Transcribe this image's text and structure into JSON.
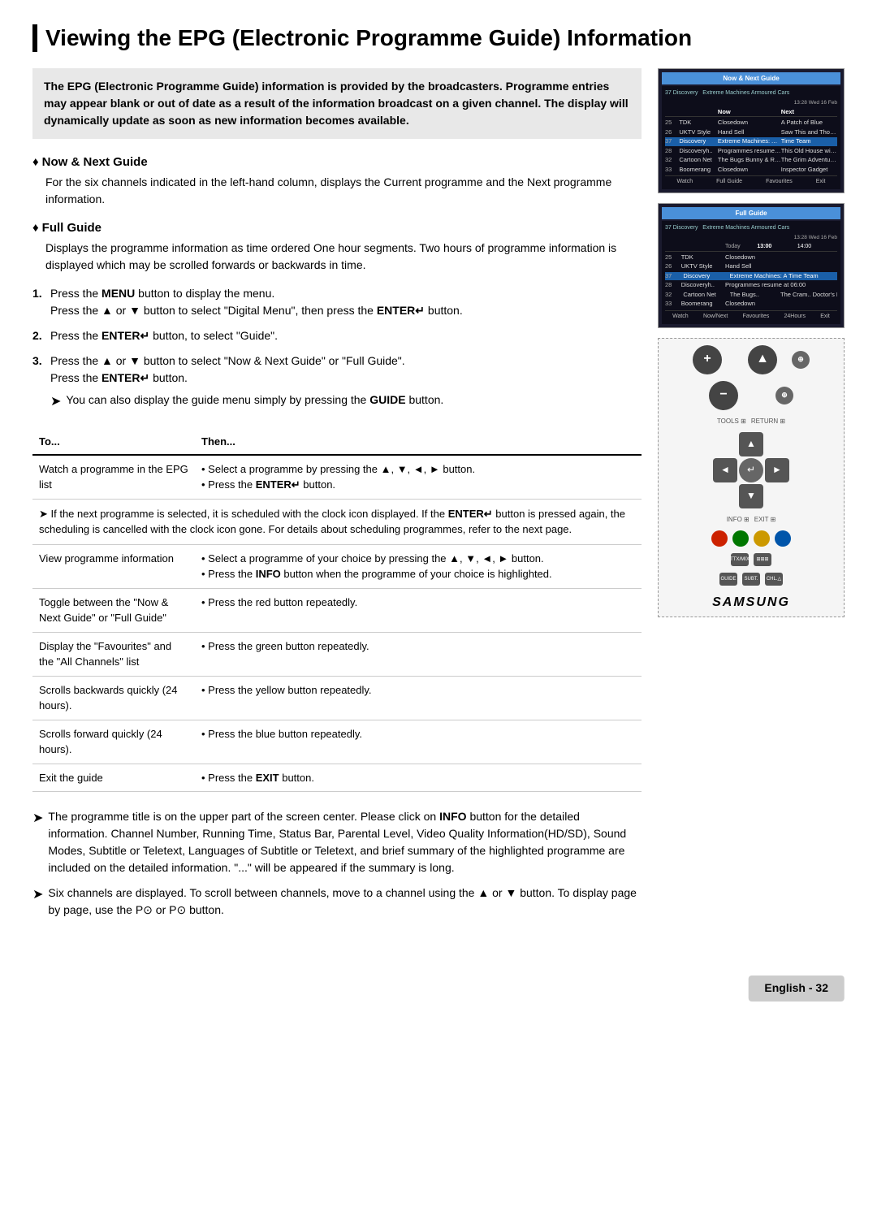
{
  "page": {
    "title": "Viewing the EPG (Electronic Programme Guide) Information",
    "intro": "The EPG (Electronic Programme Guide) information is provided by the broadcasters. Programme entries may appear blank or out of date as a result of the information broadcast on a given channel. The display will dynamically update as soon as new information becomes available.",
    "sections": [
      {
        "id": "now-next",
        "label": "Now & Next Guide",
        "description": "For the six channels indicated in the left-hand column, displays the Current programme and the Next programme information."
      },
      {
        "id": "full-guide",
        "label": "Full Guide",
        "description": "Displays the programme information as time ordered One hour segments. Two hours of programme information is displayed which may be scrolled forwards or backwards in time."
      }
    ],
    "steps": [
      {
        "num": "1.",
        "text": "Press the MENU button to display the menu.",
        "sub": "Press the ▲ or ▼ button to select \"Digital Menu\", then press the ENTER  button."
      },
      {
        "num": "2.",
        "text": "Press the ENTER  button, to select \"Guide\"."
      },
      {
        "num": "3.",
        "text": "Press the ▲ or ▼ button to select \"Now & Next Guide\" or \"Full Guide\".",
        "sub": "Press the ENTER  button.",
        "note": "You can also display the guide menu simply by pressing the GUIDE button."
      }
    ],
    "table": {
      "col1": "To...",
      "col2": "Then...",
      "rows": [
        {
          "to": "Watch a programme in the EPG list",
          "then": "• Select a programme by pressing the ▲, ▼, ◄, ► button.\n• Press the ENTER  button.",
          "note": "If the next programme is selected, it is scheduled with the clock icon displayed. If the ENTER  button is pressed again, the scheduling is cancelled with the clock icon gone. For details about scheduling programmes, refer to the next page."
        },
        {
          "to": "View programme information",
          "then": "• Select a programme of your choice by pressing the ▲, ▼, ◄, ► button.\n• Press the INFO button when the programme of your choice is highlighted."
        },
        {
          "to": "Toggle between the \"Now & Next Guide\" or \"Full Guide\"",
          "then": "• Press the red button repeatedly."
        },
        {
          "to": "Display the \"Favourites\" and the \"All Channels\" list",
          "then": "• Press the green button repeatedly."
        },
        {
          "to": "Scrolls backwards quickly (24 hours).",
          "then": "• Press the yellow button repeatedly."
        },
        {
          "to": "Scrolls forward quickly (24 hours).",
          "then": "• Press the blue button repeatedly."
        },
        {
          "to": "Exit the guide",
          "then": "• Press the EXIT button."
        }
      ]
    },
    "bottom_notes": [
      "The programme title is on the upper part of the screen center. Please click on INFO button for the detailed information. Channel Number, Running Time, Status Bar, Parental Level, Video Quality Information(HD/SD), Sound Modes, Subtitle or Teletext, Languages of Subtitle or Teletext, and brief summary of the highlighted programme are included on the detailed information. \"...\" will be appeared if the summary is long.",
      "Six channels are displayed. To scroll between channels, move to a channel using the ▲ or ▼ button. To display page by page, use the P⊙ or P⊙ button."
    ],
    "footer": "English - 32"
  },
  "sidebar": {
    "screen1": {
      "title": "Now & Next Guide",
      "datetime": "13:28 Wed 16 Feb",
      "highlight": "37 Discovery  Extreme Machines Armoured Cars",
      "channels": [
        {
          "ch": "25",
          "net": "TDK",
          "now": "Closedown",
          "next": "A Patch of Blue"
        },
        {
          "ch": "26",
          "net": "UKTV Style",
          "now": "Hand Sell",
          "next": "Saw This and Thought.."
        },
        {
          "ch": "37",
          "net": "Discovery",
          "now": "Extreme Machines: Ar...",
          "next": "Time Team"
        },
        {
          "ch": "28",
          "net": "Discoveryh..",
          "now": "Programmes resume at...",
          "next": "This Old House with St.."
        },
        {
          "ch": "32",
          "net": "Cartoon Net",
          "now": "The Bugs Bunny & Ras...",
          "next": "The Grim Adventures &.."
        },
        {
          "ch": "33",
          "net": "Boomerang",
          "now": "Closedown",
          "next": "Inspector Gadget"
        }
      ],
      "footer": [
        "Watch",
        "Full Guide",
        "Favourites",
        "Exit"
      ]
    },
    "screen2": {
      "title": "Full Guide",
      "datetime": "13:28 Wed 16 Feb",
      "highlight": "37 Discovery  Extreme Machines Armoured Cars",
      "time_headers": [
        "Today",
        "13:00",
        "14:00"
      ],
      "channels": [
        {
          "ch": "25",
          "net": "TDK",
          "col1": "Closedown",
          "col2": ""
        },
        {
          "ch": "26",
          "net": "UKTV Style",
          "col1": "Hand Sell",
          "col2": ""
        },
        {
          "ch": "37",
          "net": "Discovery",
          "col1": "Extreme Machines: Arm...",
          "col2": "Time Team"
        },
        {
          "ch": "28",
          "net": "Discoveryh..",
          "col1": "Programmes resume at 06:00",
          "col2": ""
        },
        {
          "ch": "32",
          "net": "Cartoon Net",
          "col1": "The Bugs..",
          "col2": "The Cram..  Doctor's L.."
        },
        {
          "ch": "33",
          "net": "Boomerang",
          "col1": "Closedown",
          "col2": ""
        }
      ],
      "footer": [
        "Watch",
        "Now/Next",
        "Favourites",
        "24Hours",
        "Exit"
      ]
    },
    "remote": {
      "brand": "SAMSUNG"
    }
  }
}
